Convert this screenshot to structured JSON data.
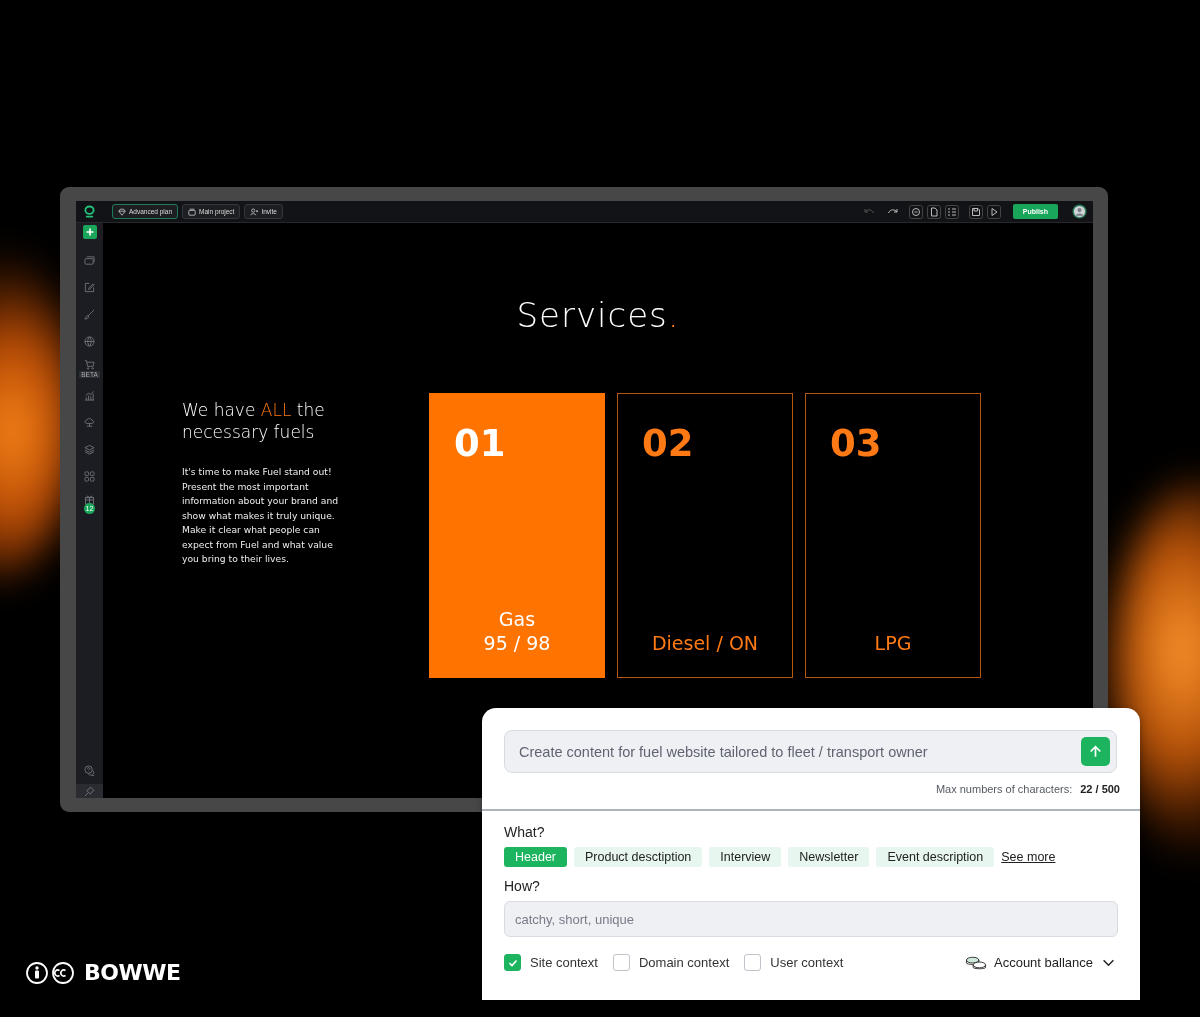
{
  "topbar": {
    "buttons": [
      {
        "kind": "plan",
        "label": "Advanced plan"
      },
      {
        "kind": "project",
        "label": "Main project"
      },
      {
        "kind": "invite",
        "label": "Invite"
      }
    ],
    "undo_disabled": true,
    "publish": "Publish"
  },
  "sidebar": {
    "beta_badge": "BETA",
    "gift_count": "12"
  },
  "canvas": {
    "title": "Services",
    "title_accent": ".",
    "heading_before": "We have",
    "heading_accent": "ALL",
    "heading_after": "the necessary fuels",
    "text": "It's time to make Fuel stand out! Present the most important information about your brand and show what makes it truly unique. Make it clear what people can expect from Fuel and what value you bring to their lives.",
    "cards": [
      {
        "number": "01",
        "label": "Gas\n95 / 98",
        "highlighted": true
      },
      {
        "number": "02",
        "label": "Diesel / ON",
        "highlighted": false
      },
      {
        "number": "03",
        "label": "LPG",
        "highlighted": false
      }
    ]
  },
  "assistant": {
    "prompt": {
      "value": "Create content for fuel website tailored to fleet / transport owner"
    },
    "counter_label": "Max numbers of characters:",
    "counter": "22 / 500",
    "what_label": "What?",
    "chips": [
      {
        "label": "Header",
        "selected": true
      },
      {
        "label": "Product desctiption",
        "selected": false
      },
      {
        "label": "Interview",
        "selected": false
      },
      {
        "label": "Newsletter",
        "selected": false
      },
      {
        "label": "Event description",
        "selected": false
      }
    ],
    "see_more": "See more",
    "how_label": "How?",
    "how_field": {
      "placeholder": "catchy, short, unique"
    },
    "contexts": [
      {
        "label": "Site context",
        "checked": true
      },
      {
        "label": "Domain context",
        "checked": false
      },
      {
        "label": "User context",
        "checked": false
      }
    ],
    "account": "Account ballance"
  },
  "brand": "BOWWE"
}
